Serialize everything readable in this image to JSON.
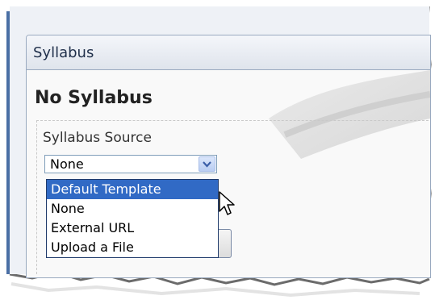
{
  "panel": {
    "title": "Syllabus"
  },
  "page": {
    "heading": "No Syllabus"
  },
  "source_field": {
    "label": "Syllabus Source",
    "selected": "None"
  },
  "dropdown": {
    "options": [
      "Default Template",
      "None",
      "External URL",
      "Upload a File"
    ],
    "highlighted_index": 0
  },
  "colors": {
    "highlight": "#316ac5",
    "header_text": "#1f2f4a",
    "left_bar": "#4a6fa5"
  },
  "icons": [
    "chevron-down-icon",
    "arrow-cursor-icon"
  ]
}
